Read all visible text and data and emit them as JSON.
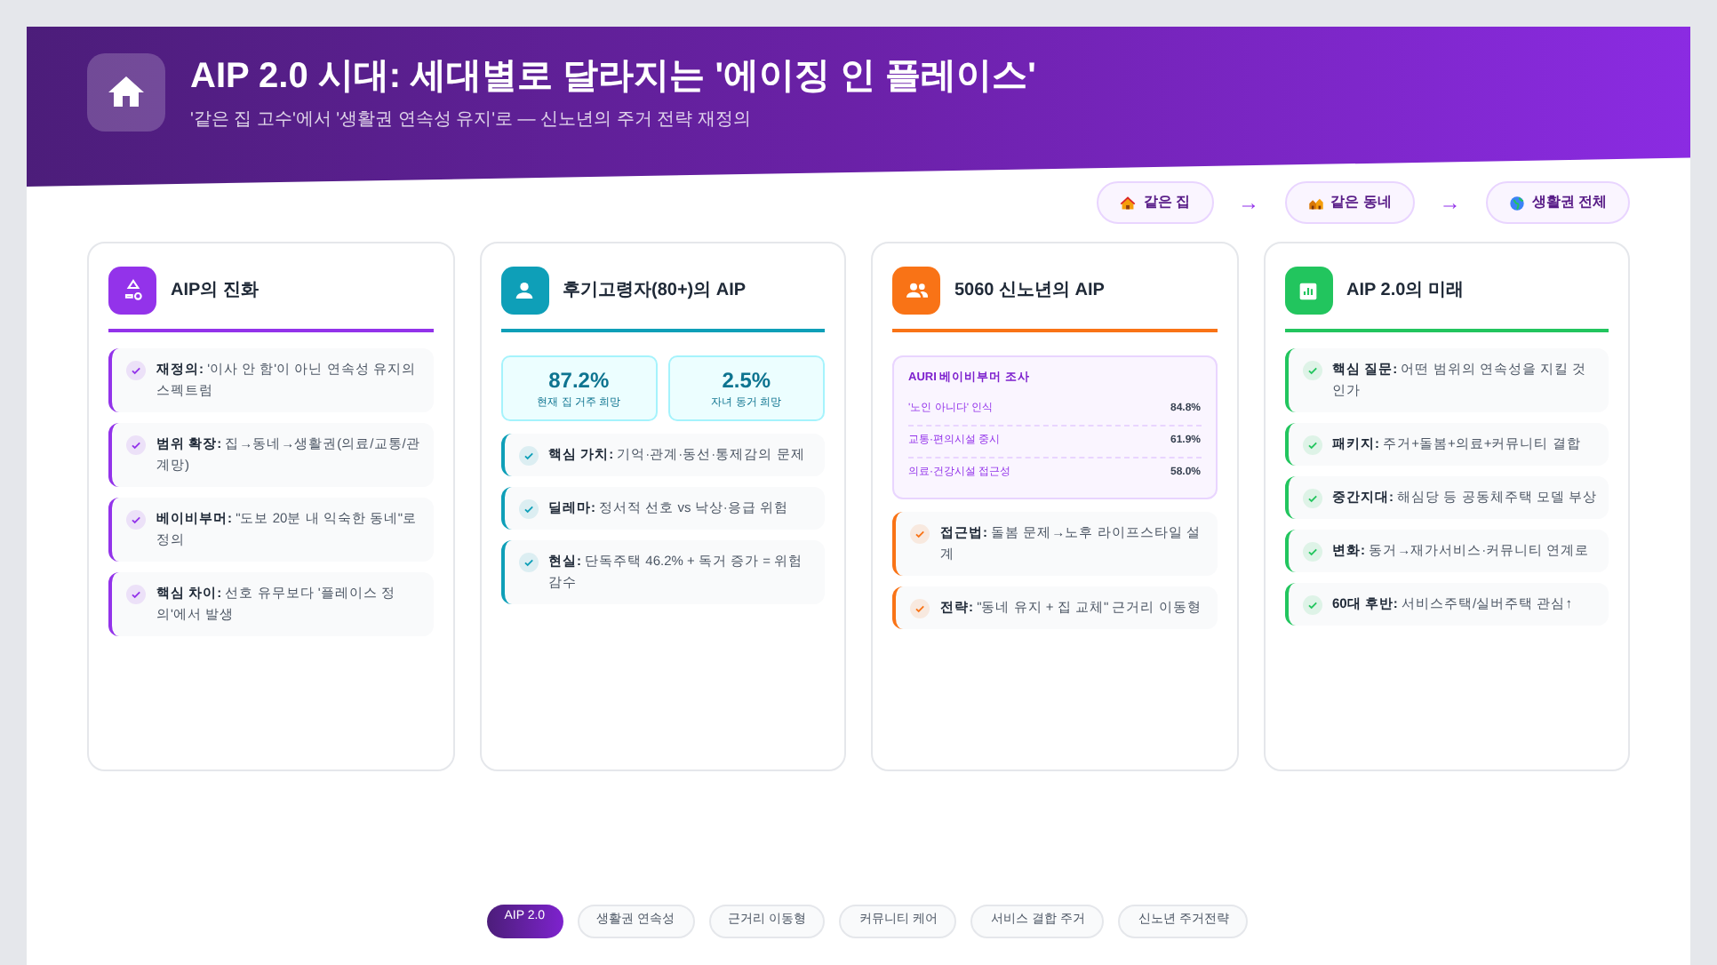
{
  "header": {
    "title": "AIP 2.0 시대: 세대별로 달라지는 '에이징 인 플레이스'",
    "subtitle": "'같은 집 고수'에서 '생활권 연속성 유지'로 — 신노년의 주거 전략 재정의"
  },
  "flow": [
    {
      "kind": "step",
      "label": "같은 집"
    },
    {
      "kind": "arrow",
      "label": "→"
    },
    {
      "kind": "step",
      "label": "같은 동네"
    },
    {
      "kind": "arrow",
      "label": "→"
    },
    {
      "kind": "step",
      "label": "생활권 전체"
    }
  ],
  "cards": [
    {
      "title": "AIP의 진화",
      "color": "#9333ea",
      "items": [
        "**재정의:** '이사 안 함'이 아닌 연속성 유지의 스펙트럼",
        "**범위 확장:** 집→동네→생활권(의료/교통/관계망)",
        "**베이비부머:** \"도보 20분 내 익숙한 동네\"로 정의",
        "**핵심 차이:** 선호 유무보다 '플레이스 정의'에서 발생"
      ]
    },
    {
      "title": "후기고령자(80+)의 AIP",
      "color": "#0e9fb8",
      "stats": [
        {
          "value": "87.2%",
          "label": "현재 집 거주 희망"
        },
        {
          "value": "2.5%",
          "label": "자녀 동거 희망"
        }
      ],
      "items": [
        "**핵심 가치:** 기억·관계·동선·통제감의 문제",
        "**딜레마:** 정서적 선호 vs 낙상·응급 위험",
        "**현실:** 단독주택 46.2% + 독거 증가 = 위험 감수"
      ]
    },
    {
      "title": "5060 신노년의 AIP",
      "color": "#f97316",
      "survey": {
        "title": "AURI 베이비부머 조사",
        "rows": [
          {
            "label": "'노인 아니다' 인식",
            "value": "84.8%"
          },
          {
            "label": "교통·편의시설 중시",
            "value": "61.9%"
          },
          {
            "label": "의료·건강시설 접근성",
            "value": "58.0%"
          }
        ]
      },
      "items": [
        "**접근법:** 돌봄 문제→노후 라이프스타일 설계",
        "**전략:** \"동네 유지 + 집 교체\" 근거리 이동형"
      ]
    },
    {
      "title": "AIP 2.0의 미래",
      "color": "#22c55e",
      "items": [
        "**핵심 질문:** 어떤 범위의 연속성을 지킬 것인가",
        "**패키지:** 주거+돌봄+의료+커뮤니티 결합",
        "**중간지대:** 해심당 등 공동체주택 모델 부상",
        "**변화:** 동거→재가서비스·커뮤니티 연계로",
        "**60대 후반:** 서비스주택/실버주택 관심↑"
      ]
    }
  ],
  "tags": [
    {
      "label": "AIP 2.0",
      "selected": true
    },
    {
      "label": "생활권 연속성",
      "selected": false
    },
    {
      "label": "근거리 이동형",
      "selected": false
    },
    {
      "label": "커뮤니티 케어",
      "selected": false
    },
    {
      "label": "서비스 결합 주거",
      "selected": false
    },
    {
      "label": "신노년 주거전략",
      "selected": false
    }
  ]
}
